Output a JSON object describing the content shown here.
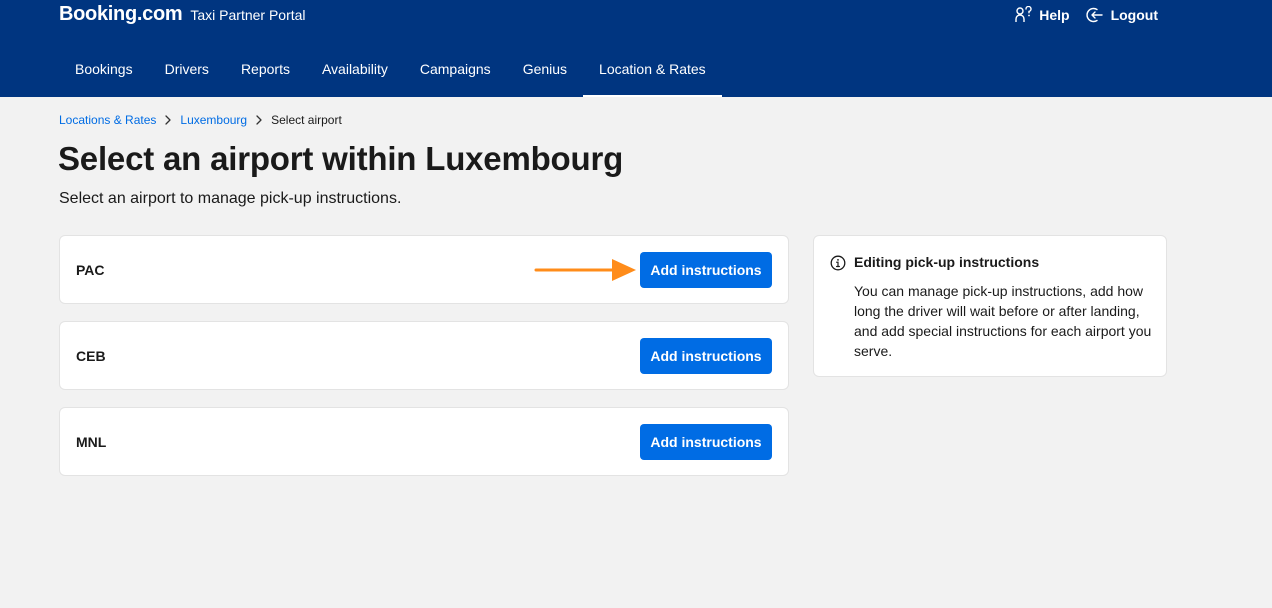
{
  "header": {
    "logo": "Booking.com",
    "portal_name": "Taxi Partner Portal",
    "help_label": "Help",
    "logout_label": "Logout"
  },
  "nav": {
    "items": [
      {
        "label": "Bookings"
      },
      {
        "label": "Drivers"
      },
      {
        "label": "Reports"
      },
      {
        "label": "Availability"
      },
      {
        "label": "Campaigns"
      },
      {
        "label": "Genius"
      },
      {
        "label": "Location & Rates",
        "active": true
      }
    ]
  },
  "breadcrumb": {
    "items": [
      "Locations & Rates",
      "Luxembourg"
    ],
    "current": "Select airport"
  },
  "page": {
    "title": "Select an airport within Luxembourg",
    "subtitle": "Select an airport to manage pick-up instructions."
  },
  "airports": [
    {
      "code": "PAC",
      "button_label": "Add instructions"
    },
    {
      "code": "CEB",
      "button_label": "Add instructions"
    },
    {
      "code": "MNL",
      "button_label": "Add instructions"
    }
  ],
  "info": {
    "icon": "info-icon",
    "title": "Editing pick-up instructions",
    "body": "You can manage pick-up instructions, add how long the driver will wait before or after landing, and add special instructions for each airport you serve."
  },
  "colors": {
    "header_bg": "#003580",
    "button_bg": "#006ce4",
    "link": "#006ce4",
    "page_bg": "#f2f2f2",
    "annotation_arrow": "#ff8c1a"
  }
}
